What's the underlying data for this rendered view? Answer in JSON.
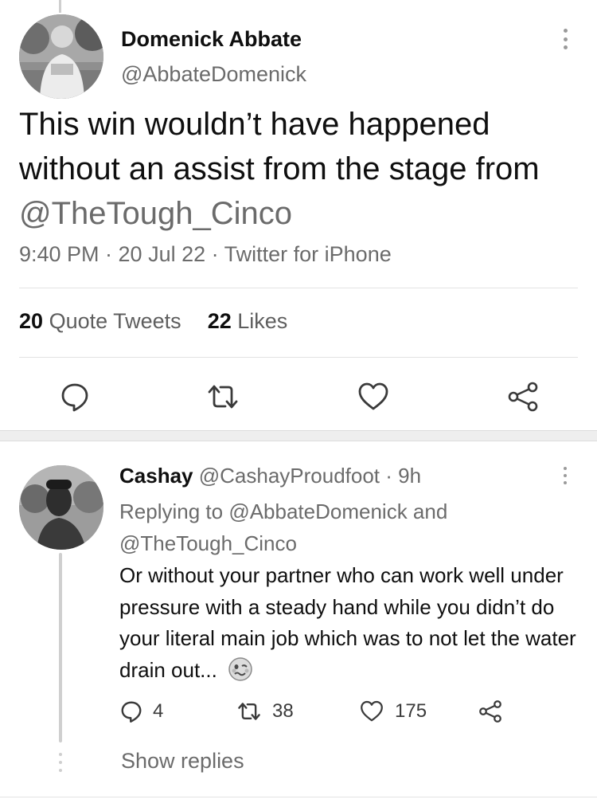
{
  "tweet": {
    "author_name": "Domenick Abbate",
    "author_handle": "@AbbateDomenick",
    "text_line1": "This win wouldn’t have happened",
    "text_line2": "without an assist from the stage from",
    "text_mention": "@TheTough_Cinco",
    "timestamp": "9:40 PM · 20 Jul 22 · Twitter for iPhone",
    "quote_tweets_count": "20",
    "quote_tweets_label": "Quote Tweets",
    "likes_count": "22",
    "likes_label": "Likes"
  },
  "icons": {
    "reply": "speech-bubble-icon",
    "retweet": "retweet-icon",
    "like": "heart-icon",
    "share": "share-icon",
    "more": "more-vertical-icon",
    "emoji": "woozy-face-emoji"
  },
  "reply": {
    "author_name": "Cashay",
    "author_handle": "@CashayProudfoot",
    "time": " · 9h",
    "replying_prefix": "Replying to ",
    "replying_to_1": "@AbbateDomenick",
    "replying_and": " and",
    "replying_to_2": "@TheTough_Cinco",
    "text": "Or without your partner who can work well under pressure with a steady hand while you didn’t do your literal main job which was to not let the water drain out...",
    "reply_count": "4",
    "retweet_count": "38",
    "like_count": "175"
  },
  "show_replies_label": "Show replies"
}
